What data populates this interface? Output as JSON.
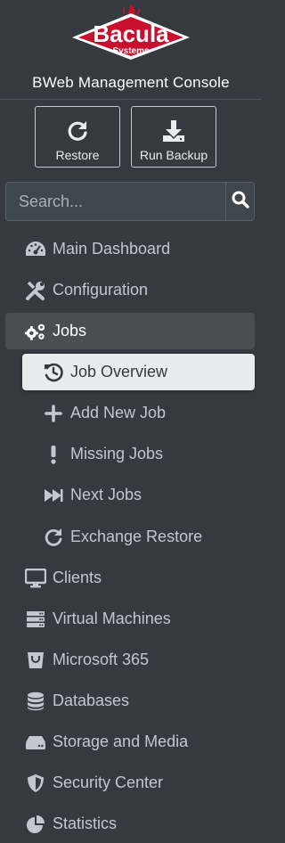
{
  "brand": {
    "logo_word": "Bacula",
    "logo_sub": "Systems",
    "console_title": "BWeb Management Console",
    "logo_red": "#c8102e"
  },
  "actions": [
    {
      "label": "Restore",
      "icon": "restore-icon"
    },
    {
      "label": "Run Backup",
      "icon": "download-icon"
    }
  ],
  "search": {
    "placeholder": "Search...",
    "icon": "search-icon"
  },
  "nav": [
    {
      "label": "Main Dashboard",
      "icon": "dashboard-gauge-icon"
    },
    {
      "label": "Configuration",
      "icon": "tools-icon"
    },
    {
      "label": "Jobs",
      "icon": "gears-icon",
      "state": "open"
    },
    {
      "label": "Job Overview",
      "icon": "history-icon",
      "state": "active",
      "level": 2
    },
    {
      "label": "Add New Job",
      "icon": "plus-icon",
      "level": 2
    },
    {
      "label": "Missing Jobs",
      "icon": "exclamation-icon",
      "level": 2
    },
    {
      "label": "Next Jobs",
      "icon": "fast-forward-icon",
      "level": 2
    },
    {
      "label": "Exchange Restore",
      "icon": "redo-icon",
      "level": 2
    },
    {
      "label": "Clients",
      "icon": "desktop-icon"
    },
    {
      "label": "Virtual Machines",
      "icon": "server-icon"
    },
    {
      "label": "Microsoft 365",
      "icon": "bucket-icon"
    },
    {
      "label": "Databases",
      "icon": "database-icon"
    },
    {
      "label": "Storage and Media",
      "icon": "hard-drive-icon"
    },
    {
      "label": "Security Center",
      "icon": "shield-icon"
    },
    {
      "label": "Statistics",
      "icon": "pie-chart-icon"
    }
  ],
  "colors": {
    "sidebar_bg": "#343a40",
    "active_parent_bg": "#494e53",
    "active_child_bg": "#e9ecef",
    "text": "#c2c7d0"
  }
}
